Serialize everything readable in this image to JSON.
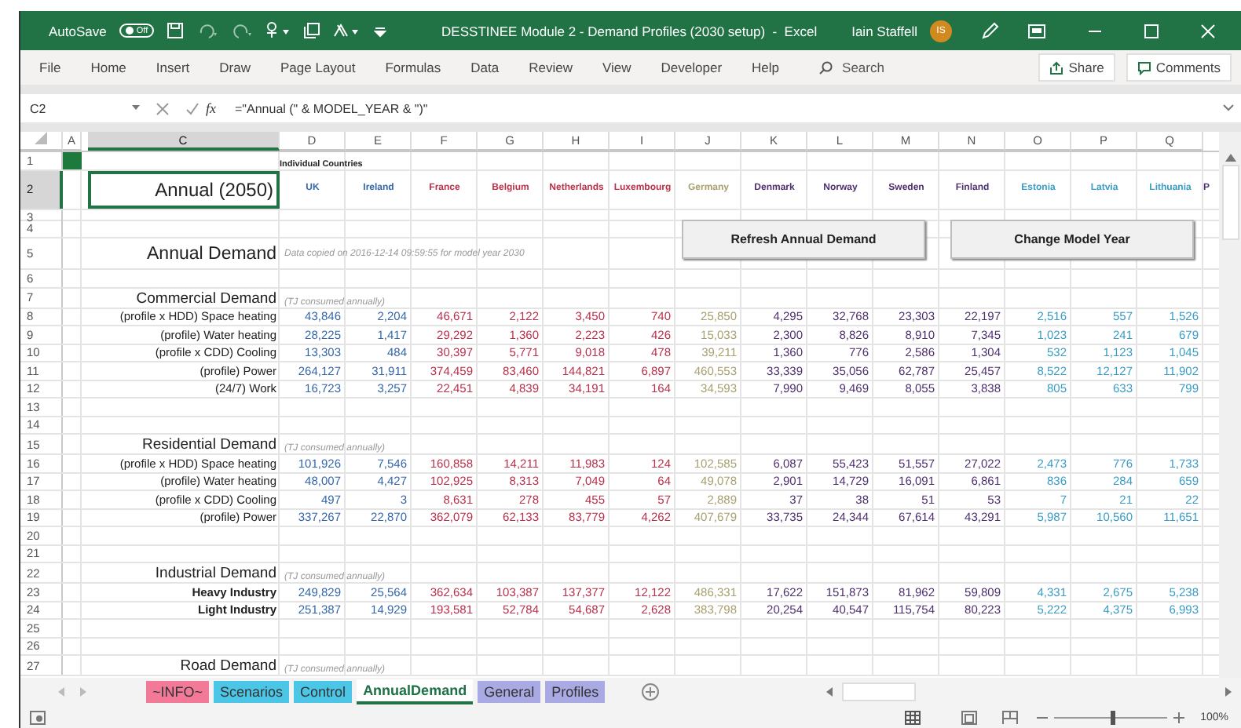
{
  "title_bar": {
    "autosave_label": "AutoSave",
    "autosave": {
      "label": "Off",
      "on": false
    },
    "title": "DESSTINEE Module 2 - Demand Profiles (2030 setup)  -  Excel",
    "user": "Iain Staffell",
    "initials": "IS"
  },
  "ribbon_tabs": [
    {
      "label": "File",
      "selected": false
    },
    {
      "label": "Home",
      "selected": false
    },
    {
      "label": "Insert",
      "selected": false
    },
    {
      "label": "Draw",
      "selected": false
    },
    {
      "label": "Page Layout",
      "selected": false
    },
    {
      "label": "Formulas",
      "selected": false
    },
    {
      "label": "Data",
      "selected": false
    },
    {
      "label": "Review",
      "selected": false
    },
    {
      "label": "View",
      "selected": false
    },
    {
      "label": "Developer",
      "selected": false
    },
    {
      "label": "Help",
      "selected": false
    }
  ],
  "search": {
    "placeholder": "Search"
  },
  "share_label": "Share",
  "comments_label": "Comments",
  "formula_bar": {
    "name_box": "C2",
    "function_label": "fx",
    "formula": "=\"Annual (\" & MODEL_YEAR & \")\""
  },
  "columns": [
    {
      "letter": "A",
      "selected": false
    },
    {
      "letter": "C",
      "selected": true
    },
    {
      "letter": "D",
      "selected": false
    },
    {
      "letter": "E",
      "selected": false
    },
    {
      "letter": "F",
      "selected": false
    },
    {
      "letter": "G",
      "selected": false
    },
    {
      "letter": "H",
      "selected": false
    },
    {
      "letter": "I",
      "selected": false
    },
    {
      "letter": "J",
      "selected": false
    },
    {
      "letter": "K",
      "selected": false
    },
    {
      "letter": "L",
      "selected": false
    },
    {
      "letter": "M",
      "selected": false
    },
    {
      "letter": "N",
      "selected": false
    },
    {
      "letter": "O",
      "selected": false
    },
    {
      "letter": "P",
      "selected": false
    },
    {
      "letter": "Q",
      "selected": false
    }
  ],
  "a1_filled": true,
  "countries": [
    {
      "name": "UK",
      "color": "#3566a8"
    },
    {
      "name": "Ireland",
      "color": "#3566a8"
    },
    {
      "name": "France",
      "color": "#b8304a"
    },
    {
      "name": "Belgium",
      "color": "#b8304a"
    },
    {
      "name": "Netherlands",
      "color": "#b8304a"
    },
    {
      "name": "Luxembourg",
      "color": "#b8304a"
    },
    {
      "name": "Germany",
      "color": "#a8a070"
    },
    {
      "name": "Denmark",
      "color": "#4e2f6e"
    },
    {
      "name": "Norway",
      "color": "#4e2f6e"
    },
    {
      "name": "Sweden",
      "color": "#4e2f6e"
    },
    {
      "name": "Finland",
      "color": "#4e2f6e"
    },
    {
      "name": "Estonia",
      "color": "#3a9cc4"
    },
    {
      "name": "Latvia",
      "color": "#3a9cc4"
    },
    {
      "name": "Lithuania",
      "color": "#3a9cc4"
    }
  ],
  "next_country_partial": "P",
  "buttons": [
    {
      "label": "Refresh Annual Demand"
    },
    {
      "label": "Change Model Year"
    }
  ],
  "rows": [
    {
      "number": "1",
      "kind": "group",
      "selected": false,
      "note": "Individual Countries"
    },
    {
      "number": "2",
      "kind": "countries",
      "selected": true,
      "label": "Annual (2050)"
    },
    {
      "number": "3",
      "kind": "spacer",
      "selected": false
    },
    {
      "number": "4",
      "kind": "blank",
      "selected": false
    },
    {
      "number": "5",
      "kind": "title",
      "selected": false,
      "label": "Annual Demand",
      "note": "Data copied on 2016-12-14 09:59:55 for model year 2030"
    },
    {
      "number": "6",
      "kind": "blank",
      "selected": false
    },
    {
      "number": "7",
      "kind": "section",
      "selected": false,
      "label": "Commercial Demand",
      "note": "(TJ consumed annually)"
    },
    {
      "number": "8",
      "kind": "data",
      "selected": false,
      "bold": false,
      "label": "(profile x HDD) Space heating",
      "values": [
        "43,846",
        "2,204",
        "46,671",
        "2,122",
        "3,450",
        "740",
        "25,850",
        "4,295",
        "32,768",
        "23,303",
        "22,197",
        "2,516",
        "557",
        "1,526"
      ]
    },
    {
      "number": "9",
      "kind": "data",
      "selected": false,
      "bold": false,
      "label": "(profile) Water heating",
      "values": [
        "28,225",
        "1,417",
        "29,292",
        "1,360",
        "2,223",
        "426",
        "15,033",
        "2,300",
        "8,826",
        "8,910",
        "7,345",
        "1,023",
        "241",
        "679"
      ]
    },
    {
      "number": "10",
      "kind": "data",
      "selected": false,
      "bold": false,
      "label": "(profile x CDD) Cooling",
      "values": [
        "13,303",
        "484",
        "30,397",
        "5,771",
        "9,018",
        "478",
        "39,211",
        "1,360",
        "776",
        "2,586",
        "1,304",
        "532",
        "1,123",
        "1,045"
      ]
    },
    {
      "number": "11",
      "kind": "data",
      "selected": false,
      "bold": false,
      "label": "(profile) Power",
      "values": [
        "264,127",
        "31,911",
        "374,459",
        "83,460",
        "144,821",
        "6,897",
        "460,553",
        "33,339",
        "35,056",
        "62,787",
        "25,457",
        "8,522",
        "12,127",
        "11,902"
      ]
    },
    {
      "number": "12",
      "kind": "data",
      "selected": false,
      "bold": false,
      "label": "(24/7) Work",
      "values": [
        "16,723",
        "3,257",
        "22,451",
        "4,839",
        "34,191",
        "164",
        "34,593",
        "7,990",
        "9,469",
        "8,055",
        "3,838",
        "805",
        "633",
        "799"
      ]
    },
    {
      "number": "13",
      "kind": "blank",
      "selected": false
    },
    {
      "number": "14",
      "kind": "blank",
      "selected": false
    },
    {
      "number": "15",
      "kind": "section",
      "selected": false,
      "label": "Residential Demand",
      "note": "(TJ consumed annually)"
    },
    {
      "number": "16",
      "kind": "data",
      "selected": false,
      "bold": false,
      "label": "(profile x HDD) Space heating",
      "values": [
        "101,926",
        "7,546",
        "160,858",
        "14,211",
        "11,983",
        "124",
        "102,585",
        "6,087",
        "55,423",
        "51,557",
        "27,022",
        "2,473",
        "776",
        "1,733"
      ]
    },
    {
      "number": "17",
      "kind": "data",
      "selected": false,
      "bold": false,
      "label": "(profile) Water heating",
      "values": [
        "48,007",
        "4,427",
        "102,925",
        "8,313",
        "7,049",
        "64",
        "49,078",
        "2,901",
        "14,729",
        "16,091",
        "6,861",
        "836",
        "284",
        "659"
      ]
    },
    {
      "number": "18",
      "kind": "data",
      "selected": false,
      "bold": false,
      "label": "(profile x CDD) Cooling",
      "values": [
        "497",
        "3",
        "8,631",
        "278",
        "455",
        "57",
        "2,889",
        "37",
        "38",
        "51",
        "53",
        "7",
        "21",
        "22"
      ]
    },
    {
      "number": "19",
      "kind": "data",
      "selected": false,
      "bold": false,
      "label": "(profile) Power",
      "values": [
        "337,267",
        "22,870",
        "362,079",
        "62,133",
        "83,779",
        "4,262",
        "407,679",
        "33,735",
        "24,344",
        "67,614",
        "43,291",
        "5,987",
        "10,560",
        "11,651"
      ]
    },
    {
      "number": "20",
      "kind": "blank",
      "selected": false
    },
    {
      "number": "21",
      "kind": "blank",
      "selected": false
    },
    {
      "number": "22",
      "kind": "section",
      "selected": false,
      "label": "Industrial Demand",
      "note": "(TJ consumed annually)"
    },
    {
      "number": "23",
      "kind": "data",
      "selected": false,
      "bold": true,
      "label": "Heavy Industry",
      "values": [
        "249,829",
        "25,564",
        "362,634",
        "103,387",
        "137,377",
        "12,122",
        "486,331",
        "17,622",
        "151,873",
        "81,962",
        "59,809",
        "4,331",
        "2,675",
        "5,238"
      ]
    },
    {
      "number": "24",
      "kind": "data",
      "selected": false,
      "bold": true,
      "label": "Light Industry",
      "values": [
        "251,387",
        "14,929",
        "193,581",
        "52,784",
        "54,687",
        "2,628",
        "383,798",
        "20,254",
        "40,547",
        "115,754",
        "80,223",
        "5,222",
        "4,375",
        "6,993"
      ]
    },
    {
      "number": "25",
      "kind": "blank",
      "selected": false
    },
    {
      "number": "26",
      "kind": "blank",
      "selected": false
    },
    {
      "number": "27",
      "kind": "section",
      "selected": false,
      "label": "Road Demand",
      "note": "(TJ consumed annually)"
    }
  ],
  "sheet_tabs": [
    {
      "label": "~INFO~",
      "color": "#f27a98",
      "selected": false
    },
    {
      "label": "Scenarios",
      "color": "#4cc6e6",
      "selected": false
    },
    {
      "label": "Control",
      "color": "#4cc6e6",
      "selected": false
    },
    {
      "label": "AnnualDemand",
      "color": "#1e7145",
      "selected": true
    },
    {
      "label": "General",
      "color": "#a9a9e4",
      "selected": false
    },
    {
      "label": "Profiles",
      "color": "#a9a9e4",
      "selected": false
    }
  ],
  "status_bar": {
    "zoom": {
      "label": "100%",
      "level": 0.5
    }
  }
}
